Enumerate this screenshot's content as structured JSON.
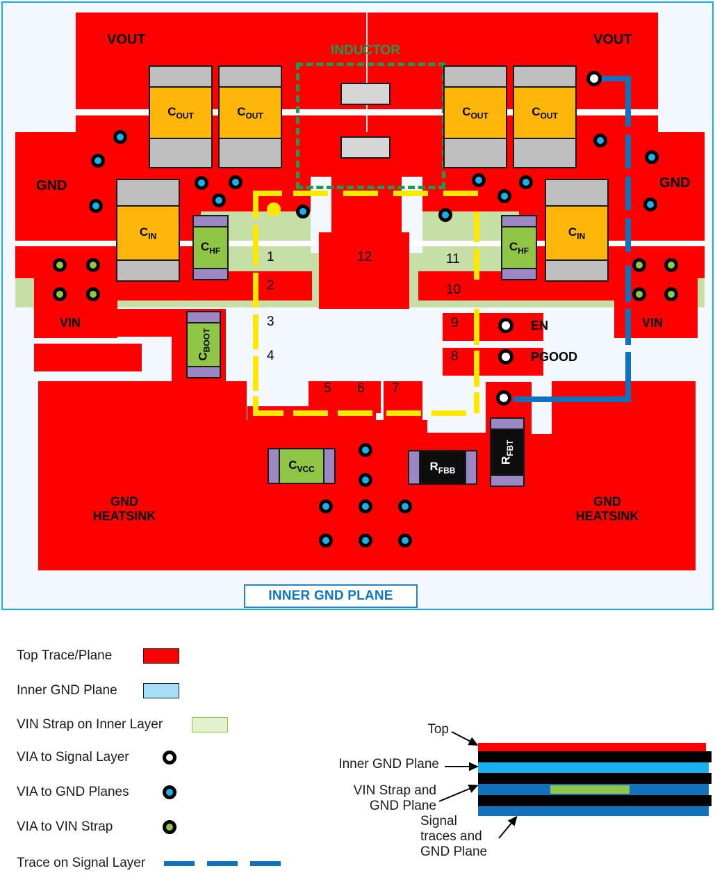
{
  "board": {
    "planes": [
      {
        "name": "vout-left",
        "label": "VOUT"
      },
      {
        "name": "vout-right",
        "label": "VOUT"
      },
      {
        "name": "gnd-left",
        "label": "GND"
      },
      {
        "name": "gnd-right",
        "label": "GND"
      },
      {
        "name": "vin-left",
        "label": "VIN"
      },
      {
        "name": "vin-right",
        "label": "VIN"
      },
      {
        "name": "gnd-heatsink-left",
        "label": "GND\nHEATSINK"
      },
      {
        "name": "gnd-heatsink-right",
        "label": "GND\nHEATSINK"
      }
    ],
    "inductor_label": "INDUCTOR",
    "inner_gnd_plane_label": "INNER GND PLANE",
    "pin_numbers": [
      "1",
      "2",
      "3",
      "4",
      "5",
      "6",
      "7",
      "8",
      "9",
      "10",
      "11",
      "12"
    ],
    "net_labels": {
      "en": "EN",
      "pgood": "PGOOD"
    },
    "components": [
      {
        "name": "cout-1",
        "label": "C",
        "sub": "OUT"
      },
      {
        "name": "cout-2",
        "label": "C",
        "sub": "OUT"
      },
      {
        "name": "cout-3",
        "label": "C",
        "sub": "OUT"
      },
      {
        "name": "cout-4",
        "label": "C",
        "sub": "OUT"
      },
      {
        "name": "cin-left",
        "label": "C",
        "sub": "IN"
      },
      {
        "name": "cin-right",
        "label": "C",
        "sub": "IN"
      },
      {
        "name": "chf-left",
        "label": "C",
        "sub": "HF"
      },
      {
        "name": "chf-right",
        "label": "C",
        "sub": "HF"
      },
      {
        "name": "cboot",
        "label": "C",
        "sub": "BOOT"
      },
      {
        "name": "cvcc",
        "label": "C",
        "sub": "VCC"
      },
      {
        "name": "rfbb",
        "label": "R",
        "sub": "FBB"
      },
      {
        "name": "rfbt",
        "label": "R",
        "sub": "FBT"
      }
    ],
    "colors": {
      "top_copper": "#FF0000",
      "inner_gnd_plane": "#A6DEF7",
      "vin_strap": "#C6DFA6",
      "via_gnd": "#1AB0EF",
      "via_signal": "#FFFFFF",
      "via_vin": "#8FC646",
      "signal_trace": "#1271BD",
      "yellow_trace": "#FFE800",
      "inductor_outline": "#1F9A52",
      "board_background": "#F2F8FD",
      "board_border": "#13B0E6"
    }
  },
  "legend": {
    "items": [
      {
        "name": "top-trace-plane",
        "label": "Top Trace/Plane",
        "swatch": "rect",
        "color": "#FF0000"
      },
      {
        "name": "inner-gnd-plane",
        "label": "Inner GND Plane",
        "swatch": "rect",
        "color": "#A6DEF7"
      },
      {
        "name": "vin-strap-inner",
        "label": "VIN Strap on Inner Layer",
        "swatch": "rect",
        "color": "#E3F1CD"
      },
      {
        "name": "via-signal-layer",
        "label": "VIA to Signal Layer",
        "swatch": "circle",
        "color": "#FFFFFF"
      },
      {
        "name": "via-gnd-planes",
        "label": "VIA to GND Planes",
        "swatch": "circle",
        "color": "#1AB0EF"
      },
      {
        "name": "via-vin-strap",
        "label": "VIA to VIN Strap",
        "swatch": "circle",
        "color": "#8FC646"
      },
      {
        "name": "trace-signal-layer",
        "label": "Trace on Signal Layer",
        "swatch": "dashes",
        "color": "#1271BD"
      }
    ]
  },
  "cross_section": {
    "callouts": {
      "top": "Top",
      "inner_gnd": "Inner GND Plane",
      "vin_strap_gnd": "VIN Strap and\nGND Plane",
      "signal_gnd": "Signal\ntraces and\nGND Plane"
    },
    "stack": [
      {
        "name": "top-copper",
        "color": "#FF0000"
      },
      {
        "name": "dielectric-1",
        "color": "#000000"
      },
      {
        "name": "inner-gnd",
        "color": "#1AB0EF"
      },
      {
        "name": "dielectric-2",
        "color": "#000000"
      },
      {
        "name": "vin-strap-gnd",
        "color": "#1271BD",
        "insert_color": "#8FC646"
      },
      {
        "name": "dielectric-3",
        "color": "#000000"
      },
      {
        "name": "signal-gnd",
        "color": "#1271BD"
      }
    ]
  }
}
